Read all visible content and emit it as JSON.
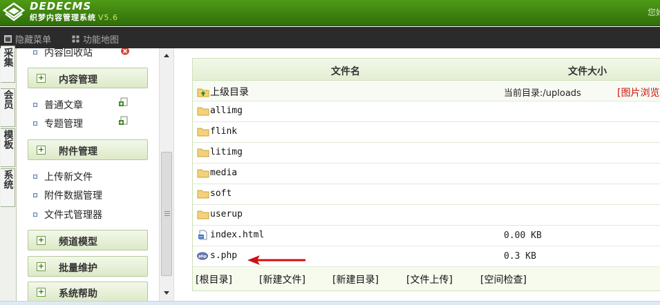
{
  "header": {
    "logo_title": "DEDECMS",
    "logo_subtitle": "织梦内容管理系统",
    "version": "V5.6",
    "greeting": "您好"
  },
  "toolbar": {
    "hide_menu": "隐藏菜单",
    "site_map": "功能地图"
  },
  "vtabs": [
    "采集",
    "会员",
    "模板",
    "系统"
  ],
  "menu": {
    "partial_top_item": "内容回收站",
    "sections": [
      {
        "title": "内容管理"
      },
      {
        "title": "附件管理"
      },
      {
        "title": "频道模型"
      },
      {
        "title": "批量维护"
      },
      {
        "title": "系统帮助"
      }
    ],
    "content_items": [
      "普通文章",
      "专题管理"
    ],
    "attach_items": [
      "上传新文件",
      "附件数据管理",
      "文件式管理器"
    ]
  },
  "table": {
    "col_name": "文件名",
    "col_size": "文件大小",
    "parent_label": "上级目录",
    "current_dir": "当前目录:/uploads",
    "image_browse": "[图片浏览]",
    "folders": [
      "allimg",
      "flink",
      "litimg",
      "media",
      "soft",
      "userup"
    ],
    "files": [
      {
        "name": "index.html",
        "size": "0.00 KB",
        "icon": "html-file-icon"
      },
      {
        "name": "s.php",
        "size": "0.3 KB",
        "icon": "php-file-icon"
      }
    ],
    "footer_links": [
      "[根目录]",
      "[新建文件]",
      "[新建目录]",
      "[文件上传]",
      "[空间检查]"
    ]
  },
  "colors": {
    "header_green": "#3f8512",
    "toolbar_bg": "#2b2b2b",
    "annotation_arrow": "#d01010"
  }
}
